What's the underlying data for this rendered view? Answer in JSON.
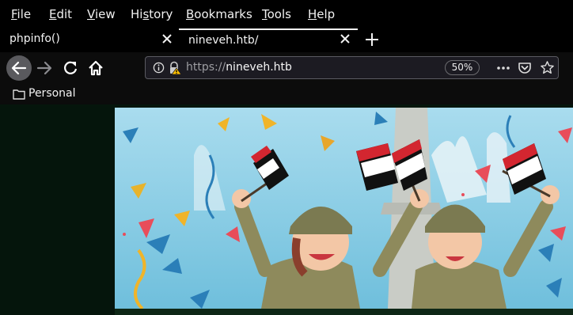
{
  "menu": [
    {
      "label": "File",
      "mnemonic": "F",
      "rest": "ile"
    },
    {
      "label": "Edit",
      "mnemonic": "E",
      "rest": "dit"
    },
    {
      "label": "View",
      "mnemonic": "V",
      "rest": "iew"
    },
    {
      "label": "History",
      "pre": "Hi",
      "mnemonic": "s",
      "rest": "tory"
    },
    {
      "label": "Bookmarks",
      "mnemonic": "B",
      "rest": "ookmarks"
    },
    {
      "label": "Tools",
      "mnemonic": "T",
      "rest": "ools"
    },
    {
      "label": "Help",
      "mnemonic": "H",
      "rest": "elp"
    }
  ],
  "tabs": [
    {
      "label": "phpinfo()",
      "active": false
    },
    {
      "label": "nineveh.htb/",
      "active": true
    }
  ],
  "url": {
    "protocol": "https://",
    "host": "nineveh.htb",
    "zoom": "50%"
  },
  "bookmarks": {
    "folder_label": "Personal"
  },
  "colors": {
    "background": "#000000",
    "toolbar": "#0c0c0c",
    "urlbar": "#1c1b22",
    "page_background": "#05150c",
    "sky": "#7fc8e2"
  },
  "icons": [
    "back-arrow-icon",
    "forward-arrow-icon",
    "reload-icon",
    "home-icon",
    "info-icon",
    "insecure-lock-icon",
    "more-actions-icon",
    "pocket-icon",
    "bookmark-star-icon",
    "folder-icon",
    "close-icon",
    "plus-icon"
  ]
}
